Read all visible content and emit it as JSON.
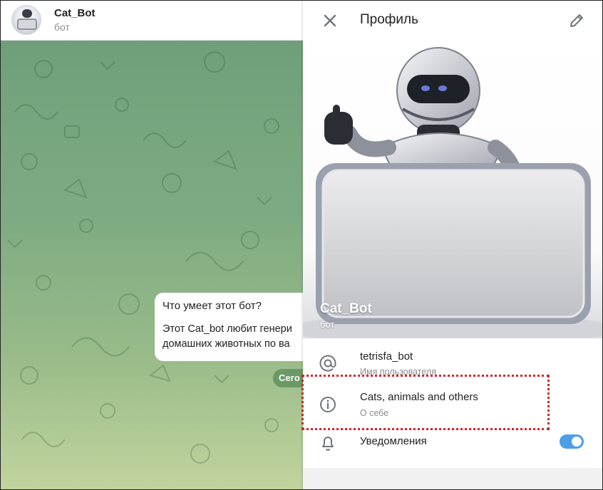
{
  "chat": {
    "title": "Cat_Bot",
    "subtitle": "бот",
    "message": {
      "title": "Что умеет этот бот?",
      "body_line1": "Этот Cat_bot любит генери",
      "body_line2": "домашних животных по ва"
    },
    "date_pill": "Сего"
  },
  "profile": {
    "title": "Профиль",
    "name": "Cat_Bot",
    "subtitle": "бот",
    "username": "tetrisfa_bot",
    "username_label": "Имя пользователя",
    "about": "Cats, animals and others",
    "about_label": "О себе",
    "notifications_label": "Уведомления",
    "notifications_enabled": true
  },
  "colors": {
    "accent": "#4c9ee6",
    "highlight": "#d8232a"
  },
  "icons": [
    "close-icon",
    "pencil-icon",
    "at-icon",
    "info-icon",
    "bell-icon"
  ]
}
